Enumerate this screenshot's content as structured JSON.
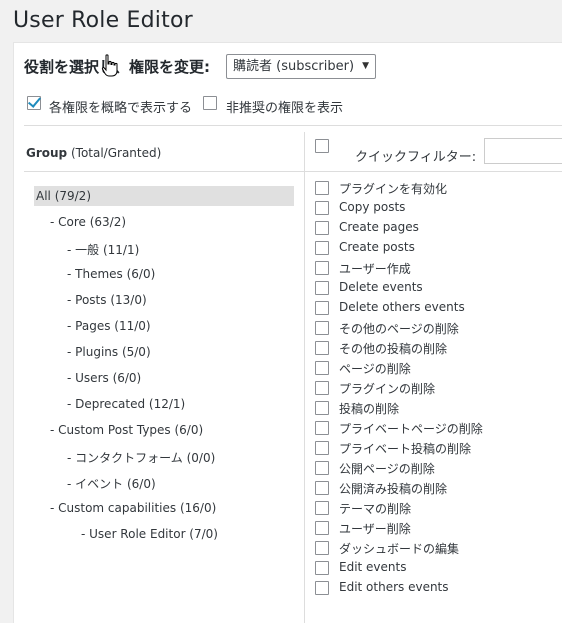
{
  "page": {
    "title": "User Role Editor"
  },
  "role": {
    "label": "役割を選択し、権限を変更:",
    "selected": "購読者 (subscriber)"
  },
  "options": {
    "show_readable": {
      "label": "各権限を概略で表示する",
      "checked": true
    },
    "show_deprecated": {
      "label": "非推奨の権限を表示",
      "checked": false
    }
  },
  "groups": {
    "header_bold": "Group",
    "header_rest": " (Total/Granted)",
    "items": [
      {
        "label": "All (79/2)"
      },
      {
        "label": "- Core (63/2)"
      },
      {
        "label": "- 一般 (11/1)"
      },
      {
        "label": "- Themes (6/0)"
      },
      {
        "label": "- Posts (13/0)"
      },
      {
        "label": "- Pages (11/0)"
      },
      {
        "label": "- Plugins (5/0)"
      },
      {
        "label": "- Users (6/0)"
      },
      {
        "label": "- Deprecated (12/1)"
      },
      {
        "label": "- Custom Post Types (6/0)"
      },
      {
        "label": "- コンタクトフォーム (0/0)"
      },
      {
        "label": "- イベント (6/0)"
      },
      {
        "label": "- Custom capabilities (16/0)"
      },
      {
        "label": "- User Role Editor (7/0)"
      }
    ]
  },
  "quick_filter": {
    "label": "クイックフィルター:",
    "value": ""
  },
  "capabilities": [
    {
      "label": "プラグインを有効化"
    },
    {
      "label": "Copy posts"
    },
    {
      "label": "Create pages"
    },
    {
      "label": "Create posts"
    },
    {
      "label": "ユーザー作成"
    },
    {
      "label": "Delete events"
    },
    {
      "label": "Delete others events"
    },
    {
      "label": "その他のページの削除"
    },
    {
      "label": "その他の投稿の削除"
    },
    {
      "label": "ページの削除"
    },
    {
      "label": "プラグインの削除"
    },
    {
      "label": "投稿の削除"
    },
    {
      "label": "プライベートページの削除"
    },
    {
      "label": "プライベート投稿の削除"
    },
    {
      "label": "公開ページの削除"
    },
    {
      "label": "公開済み投稿の削除"
    },
    {
      "label": "テーマの削除"
    },
    {
      "label": "ユーザー削除"
    },
    {
      "label": "ダッシュボードの編集"
    },
    {
      "label": "Edit events"
    },
    {
      "label": "Edit others events"
    }
  ]
}
